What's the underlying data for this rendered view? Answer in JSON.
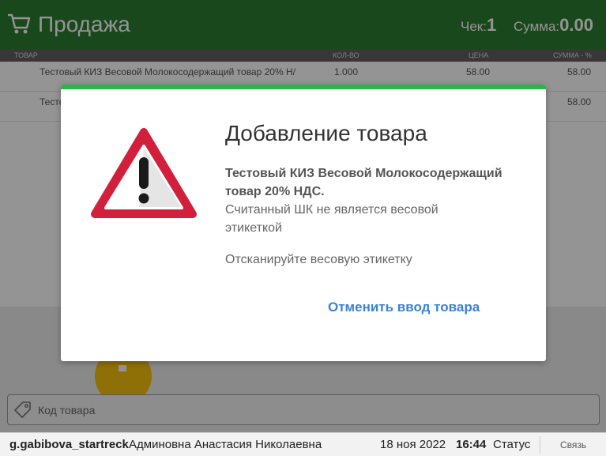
{
  "header": {
    "title": "Продажа",
    "receipt_label": "Чек:",
    "receipt_number": "1",
    "total_label": "Сумма:",
    "total_value": "0.00",
    "icon": "cart-icon",
    "bg_color": "#2e7d32"
  },
  "table": {
    "columns": [
      "ТОВАР",
      "КОЛ-ВО",
      "ЦЕНА",
      "СУММА - %"
    ],
    "rows": [
      {
        "name": "Тестовый КИЗ Весовой Молокосодержащий товар 20% Н/",
        "qty": "1.000",
        "price": "58.00",
        "sum": "58.00"
      },
      {
        "name": "Тесто",
        "qty": "",
        "price": "",
        "sum": "58.00"
      }
    ]
  },
  "code_field": {
    "placeholder": "Код товара",
    "icon": "tag-icon"
  },
  "statusbar": {
    "login": "g.gabibova_startreck",
    "user": "Админовна Анастасия Николаевна",
    "date": "18 ноя 2022",
    "time": "16:44",
    "status": "Статус",
    "link": "Связь"
  },
  "dialog": {
    "title": "Добавление товара",
    "product": "Тестовый КИЗ Весовой Молокосодержащий товар 20% НДС.",
    "message": "Считанный ШК не является весовой этикеткой",
    "hint": "Отсканируйте весовую этикетку",
    "cancel_label": "Отменить ввод товара",
    "icon": "warning-icon",
    "accent_color": "#2cb34a",
    "warning_color": "#d21f3c",
    "link_color": "#3b82d6"
  }
}
